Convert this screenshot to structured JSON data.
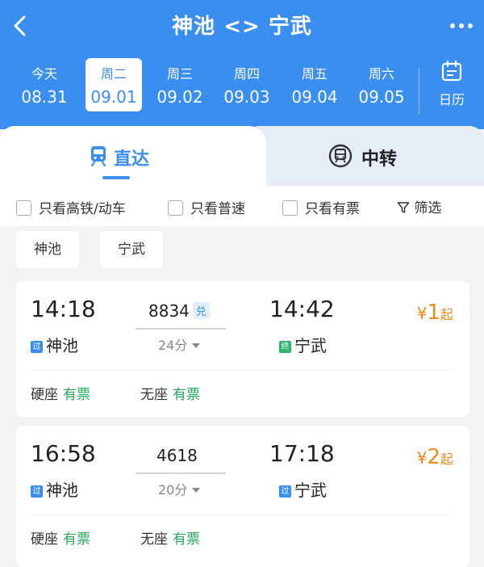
{
  "header": {
    "title": "神池 <> 宁武",
    "back_icon": "back-arrow-icon",
    "more_icon": "more-dots-icon",
    "bg_color": "#3a8ef0"
  },
  "dates": [
    {
      "weekday": "今天",
      "date": "08.31",
      "selected": false
    },
    {
      "weekday": "周二",
      "date": "09.01",
      "selected": true
    },
    {
      "weekday": "周三",
      "date": "09.02",
      "selected": false
    },
    {
      "weekday": "周四",
      "date": "09.03",
      "selected": false
    },
    {
      "weekday": "周五",
      "date": "09.04",
      "selected": false
    },
    {
      "weekday": "周六",
      "date": "09.05",
      "selected": false
    }
  ],
  "calendar": {
    "label": "日历",
    "icon": "calendar-icon"
  },
  "tabs": [
    {
      "label": "直达",
      "icon": "train-icon",
      "active": true
    },
    {
      "label": "中转",
      "icon": "transfer-icon",
      "active": false
    }
  ],
  "filters": {
    "gaotie": "只看高铁/动车",
    "pusu": "只看普速",
    "youpiao": "只看有票",
    "filter": "筛选"
  },
  "stations": {
    "from": "神池",
    "to": "宁武"
  },
  "trains": [
    {
      "dep_time": "14:18",
      "arr_time": "14:42",
      "train_no": "8834",
      "badge": "兑",
      "duration": "24分",
      "dep_station": "神池",
      "dep_tag": "过",
      "arr_station": "宁武",
      "arr_tag": "终",
      "price_symbol": "¥",
      "price": "1",
      "price_suffix": "起",
      "seats": [
        {
          "name": "硬座",
          "status": "有票"
        },
        {
          "name": "无座",
          "status": "有票"
        }
      ]
    },
    {
      "dep_time": "16:58",
      "arr_time": "17:18",
      "train_no": "4618",
      "badge": "",
      "duration": "20分",
      "dep_station": "神池",
      "dep_tag": "过",
      "arr_station": "宁武",
      "arr_tag": "过",
      "price_symbol": "¥",
      "price": "2",
      "price_suffix": "起",
      "seats": [
        {
          "name": "硬座",
          "status": "有票"
        },
        {
          "name": "无座",
          "status": "有票"
        }
      ]
    }
  ],
  "colors": {
    "accent": "#3a8ef0",
    "price": "#f08a1c",
    "available": "#24a85a",
    "tag_pass": "#3a8ef0",
    "tag_end": "#2fb36c"
  }
}
